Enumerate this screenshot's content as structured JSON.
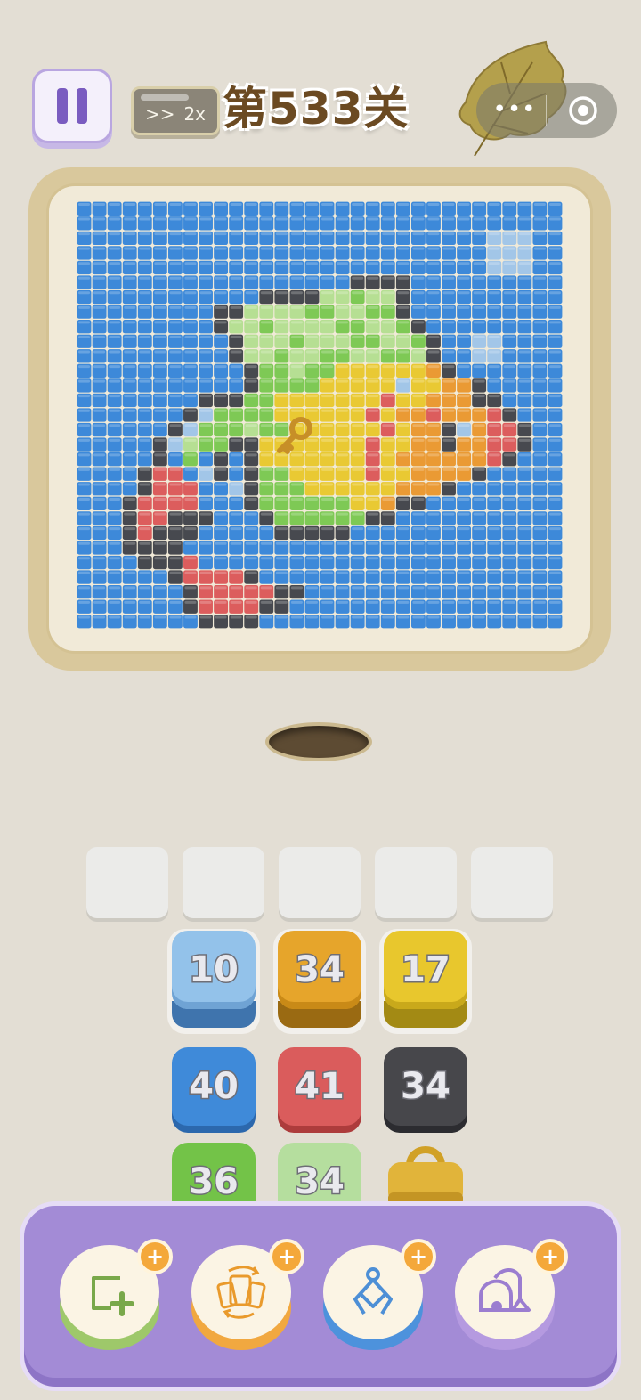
{
  "header": {
    "speed_label_arrows": ">>",
    "speed_label_value": "2x",
    "level_title": "第533关"
  },
  "icons": {
    "pause": "pause-icon",
    "more": "more-dots-icon",
    "close": "target-circle-icon",
    "leaf": "leaf-decoration",
    "key": "key-icon"
  },
  "colors": {
    "background": "#e3ded4",
    "accent_purple": "#a38bd6",
    "board_frame": "#d9c89c"
  },
  "slots": {
    "count": 5,
    "filled": 0
  },
  "tiles": [
    {
      "id": "blue-light",
      "count": "10",
      "color": "#8fc0ea",
      "stacked": true,
      "highlighted": true
    },
    {
      "id": "orange",
      "count": "34",
      "color": "#e5a42a",
      "stacked": true,
      "highlighted": true
    },
    {
      "id": "yellow",
      "count": "17",
      "color": "#e6c72c",
      "stacked": true,
      "highlighted": true
    },
    {
      "id": "blue",
      "count": "40",
      "color": "#3d87d8",
      "stacked": false,
      "highlighted": false
    },
    {
      "id": "red",
      "count": "41",
      "color": "#d95b5b",
      "stacked": false,
      "highlighted": false
    },
    {
      "id": "dark",
      "count": "34",
      "color": "#46464a",
      "stacked": false,
      "highlighted": false
    },
    {
      "id": "green",
      "count": "36",
      "color": "#72c247",
      "stacked": false,
      "highlighted": false
    },
    {
      "id": "light-green",
      "count": "34",
      "color": "#b3dd9c",
      "stacked": false,
      "highlighted": false
    }
  ],
  "toolbar": {
    "items": [
      {
        "name": "add-slot",
        "icon": "add-square-icon",
        "badge": "+",
        "base_color": "#9ec86a"
      },
      {
        "name": "shuffle",
        "icon": "shuffle-cards-icon",
        "badge": "+",
        "base_color": "#f1a840"
      },
      {
        "name": "grab-claw",
        "icon": "claw-icon",
        "badge": "+",
        "base_color": "#4d92dc"
      },
      {
        "name": "vacuum",
        "icon": "vacuum-icon",
        "badge": "+",
        "base_color": "#b59ae0"
      }
    ]
  },
  "pixel_art": {
    "palette": {
      "B": "#3d89d9",
      "L": "#a2c6e8",
      "K": "#47494f",
      "G": "#7ec955",
      "H": "#b6df93",
      "Y": "#e9c933",
      "O": "#ea9a34",
      "R": "#dc5d5d"
    },
    "rows": [
      "BBBBBBBBBBBBBBBBBBBBBBBBBBBBBBBB",
      "BBBBBBBBBBBBBBBBBBBBBBBBBBBBBBBB",
      "BBBBBBBBBBBBBBBBBBBBBBBBBBBLLLBB",
      "BBBBBBBBBBBBBBBBBBBBBBBBBBBLLLBB",
      "BBBBBBBBBBBBBBBBBBBBBBBBBBBLLLBB",
      "BBBBBBBBBBBBBBBBBBKKKKBBBBBBBBBB",
      "BBBBBBBBBBBBKKKKHHGHHKBBBBBBBBBB",
      "BBBBBBBBBKKHHHHGGHHGGKBBBBBBBBBB",
      "BBBBBBBBBKHHGHHHHGGHHGKBBBBBBBBB",
      "BBBBBBBBBBKHHHGHHHGGHHGKBBLLBBBB",
      "BBBBBBBBBBKHHGHHGGHHGGHKBBLLBBBB",
      "BBBBBBBBBBBKGGHGGYYYYYYOKBBBBBBB",
      "BBBBBBBBBBBKGGGGYYYYYLYYOOKBBBBB",
      "BBBBBBBBKKKGGYYYYYYYRYYOOOKKBBBB",
      "BBBBBBBKLGGGGYYYYYYRYOOROOORKBBB",
      "BBBBBBKLGGGHGGYYYYYYRYOOKLORRKBB",
      "BBBBBKLHGGKKYYYYYYYRYYOOKOORRKBB",
      "BBBBBKBGBKBKYYYYYYYRYOOOOOORKBBB",
      "BBBBKRRBLKBKGGYYYYYRYYOOOOKBBBBB",
      "BBBBKRRRBBLKGGGYYYYYYOOOKBBBBBBB",
      "BBBKRRRRBBBKGGGGGGYYOKKBBBBBBBBB",
      "BBBKRRKKKBBBKGGGGGGKKBBBBBBBBBBB",
      "BBBKRKKKBBBBBKKKKKBBBBBBBBBBBBBB",
      "BBBKKKKBBBBBBBBBBBBBBBBBBBBBBBBB",
      "BBBBKKKRBBBBBBBBBBBBBBBBBBBBBBBB",
      "BBBBBBKRRRRKBBBBBBBBBBBBBBBBBBBB",
      "BBBBBBBKRRRRRKKBBBBBBBBBBBBBBBBB",
      "BBBBBBBKRRRRKKBBBBBBBBBBBBBBBBBB",
      "BBBBBBBBKKKKBBBBBBBBBBBBBBBBBBBB"
    ]
  }
}
